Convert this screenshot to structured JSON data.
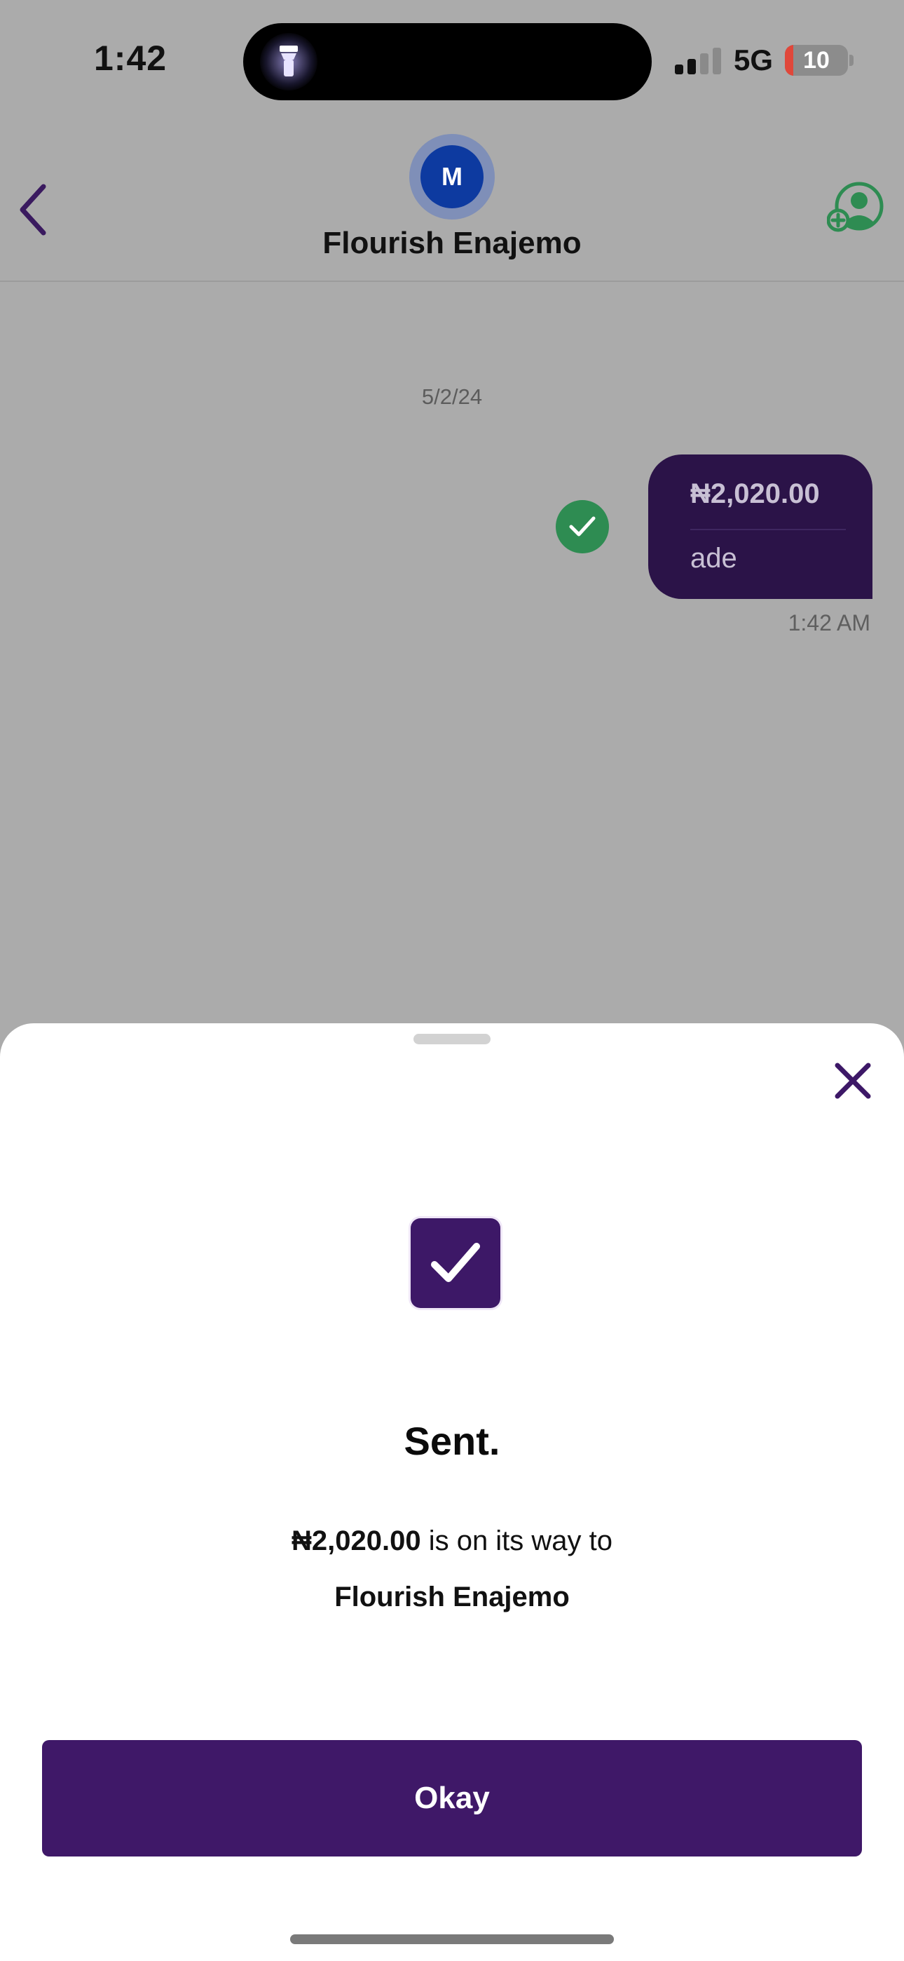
{
  "status_bar": {
    "time": "1:42",
    "network": "5G",
    "battery": "10",
    "battery_color": "#e0473a"
  },
  "chat_header": {
    "back_icon": "chevron-left-icon",
    "avatar_initial": "M",
    "contact_name": "Flourish Enajemo",
    "add_contact_icon": "add-person-icon"
  },
  "chat": {
    "date": "5/2/24",
    "message": {
      "amount": "₦2,020.00",
      "note": "ade",
      "time": "1:42 AM",
      "status_icon": "check-circle-icon"
    }
  },
  "sheet": {
    "close_icon": "close-icon",
    "success_icon": "checkbox-check-icon",
    "title": "Sent.",
    "amount": "₦2,020.00",
    "line1_suffix": " is on its way to",
    "recipient": "Flourish Enajemo",
    "okay_label": "Okay"
  },
  "colors": {
    "brand_purple": "#3f1868",
    "bubble_purple": "#2b1348",
    "success_green": "#2e8c52",
    "avatar_blue": "#0d3aa0"
  }
}
